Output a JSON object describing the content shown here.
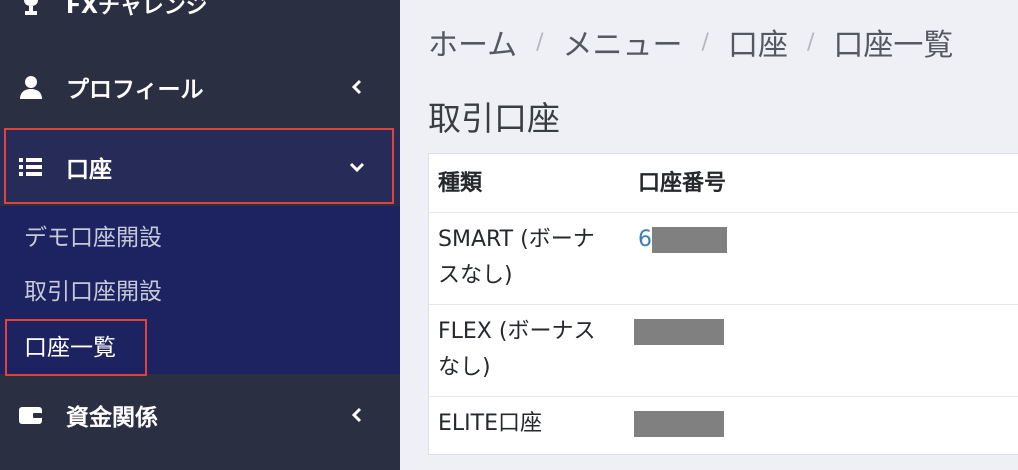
{
  "sidebar": {
    "brand": "FXチャレンジ",
    "profile": "プロフィール",
    "account": "口座",
    "submenu": [
      "デモ口座開設",
      "取引口座開設",
      "口座一覧"
    ],
    "funds": "資金関係"
  },
  "breadcrumb": [
    "ホーム",
    "メニュー",
    "口座",
    "口座一覧"
  ],
  "breadcrumb_separator": "/",
  "page_title": "取引口座",
  "table": {
    "headers": [
      "種類",
      "口座番号"
    ],
    "rows": [
      {
        "type_line1": "SMART (ボーナ",
        "type_line2": "スなし)",
        "number_visible": "6"
      },
      {
        "type_line1": "FLEX (ボーナス",
        "type_line2": "なし)",
        "number_visible": ""
      },
      {
        "type_line1": "ELITE口座",
        "type_line2": "",
        "number_visible": ""
      }
    ]
  },
  "colors": {
    "sidebar_bg": "#2b2f42",
    "submenu_bg": "#1d2260",
    "highlight_outline": "#e0433a",
    "link": "#3a7fb5",
    "redaction": "#808080"
  }
}
